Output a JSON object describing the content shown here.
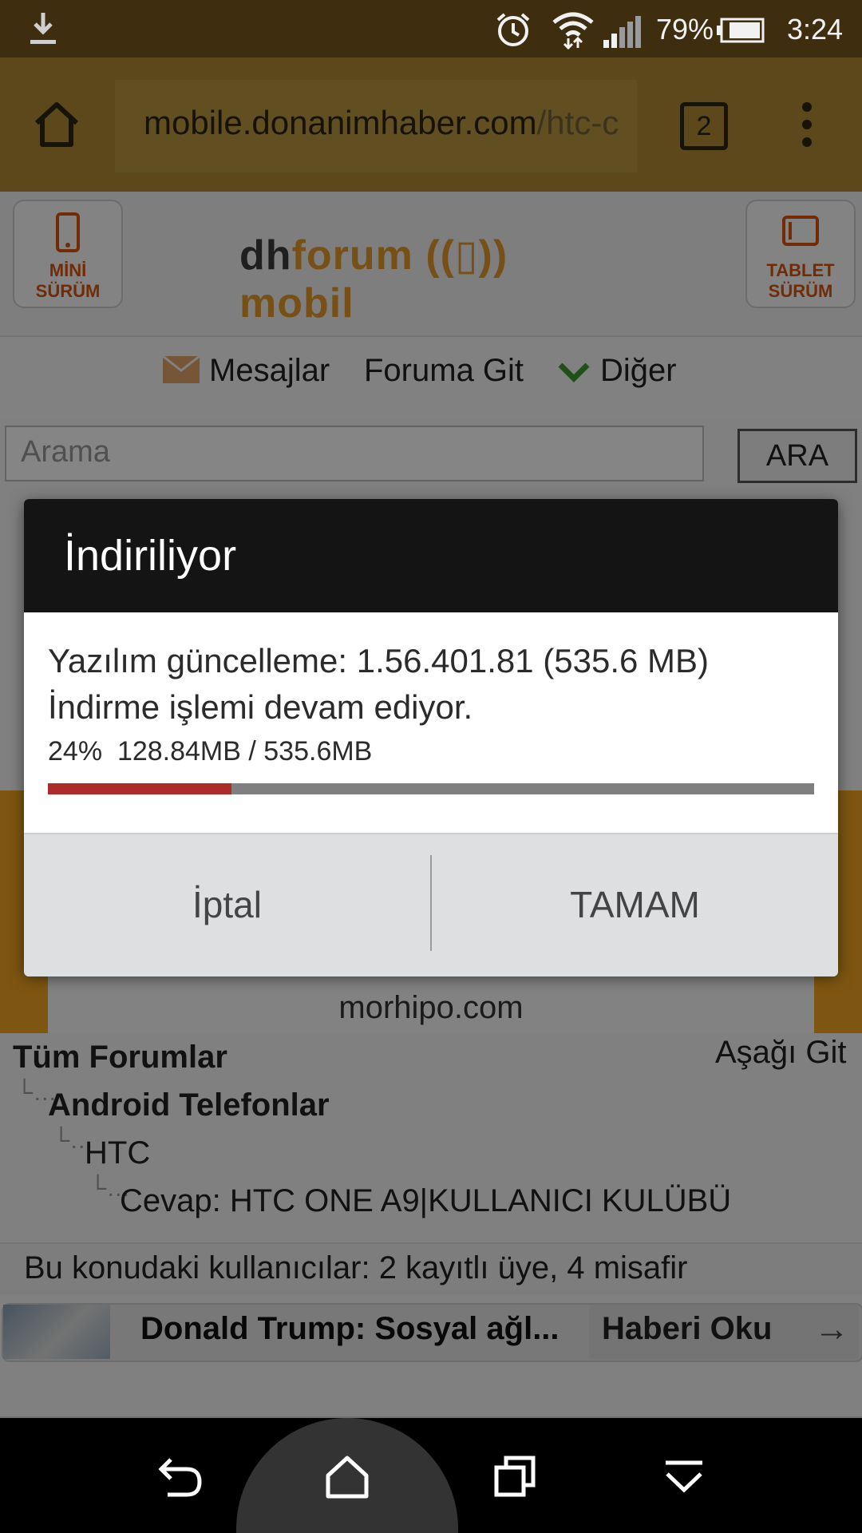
{
  "status_bar": {
    "battery_percent": "79%",
    "time": "3:24",
    "icons": [
      "download-icon",
      "alarm-icon",
      "wifi-icon",
      "signal-icon",
      "battery-icon"
    ]
  },
  "browser": {
    "url_prefix": "mobile.donanimhaber.com",
    "url_path": "/htc-c",
    "tab_count": "2",
    "icons": [
      "home-icon",
      "overflow-menu-icon"
    ]
  },
  "site": {
    "mini_label": "MİNİ\nSÜRÜM",
    "tablet_label": "TABLET\nSÜRÜM",
    "logo_dh": "dh",
    "logo_rest": "forum",
    "logo_mobil": "mobil",
    "menu": {
      "messages": "Mesajlar",
      "goto_forum": "Foruma Git",
      "other": "Diğer"
    },
    "search_placeholder": "Arama",
    "search_button": "ARA",
    "ad_domain": "morhipo.com",
    "breadcrumbs": {
      "all_forums": "Tüm Forumlar",
      "go_down": "Aşağı Git",
      "android": "Android Telefonlar",
      "htc": "HTC",
      "thread": "Cevap: HTC ONE A9|KULLANICI KULÜBÜ"
    },
    "viewers": "Bu konudaki kullanıcılar: 2 kayıtlı üye, 4 misafir",
    "news": {
      "title": "Donald Trump: Sosyal ağl...",
      "cta": "Haberi Oku",
      "arrow": "→"
    }
  },
  "dialog": {
    "title": "İndiriliyor",
    "line1": "Yazılım güncelleme: 1.56.401.81 (535.6 MB)",
    "line2": "İndirme işlemi devam ediyor.",
    "progress_text": "24%  128.84MB / 535.6MB",
    "progress_fraction": 0.24,
    "cancel_label": "İptal",
    "ok_label": "TAMAM",
    "accent_color": "#ad2b2b"
  },
  "nav_bar": {
    "icons": [
      "back-icon",
      "home-icon",
      "recents-icon",
      "hide-nav-icon"
    ]
  }
}
